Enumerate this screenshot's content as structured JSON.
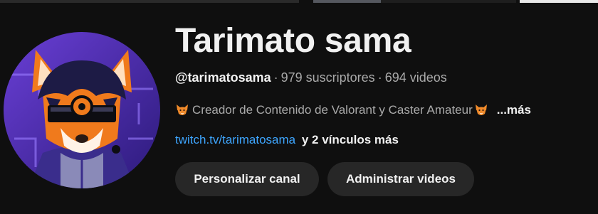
{
  "channel": {
    "name": "Tarimato sama",
    "handle": "@tarimatosama",
    "subscribers": "979 suscriptores",
    "videos": "694 videos",
    "separator": "·",
    "description": "Creador de Contenido de Valorant y Caster Amateur",
    "more_label": "...más",
    "link_text": "twitch.tv/tarimatosama",
    "extra_links_label": "y 2 vínculos más"
  },
  "actions": {
    "customize_label": "Personalizar canal",
    "manage_label": "Administrar videos"
  },
  "icons": {
    "avatar": "fox-avatar-icon",
    "emoji": "fox-face-icon"
  },
  "colors": {
    "background": "#0f0f0f",
    "button_bg": "#272727",
    "link": "#3ea6ff",
    "secondary_text": "#aaaaaa",
    "primary_text": "#f1f1f1"
  }
}
